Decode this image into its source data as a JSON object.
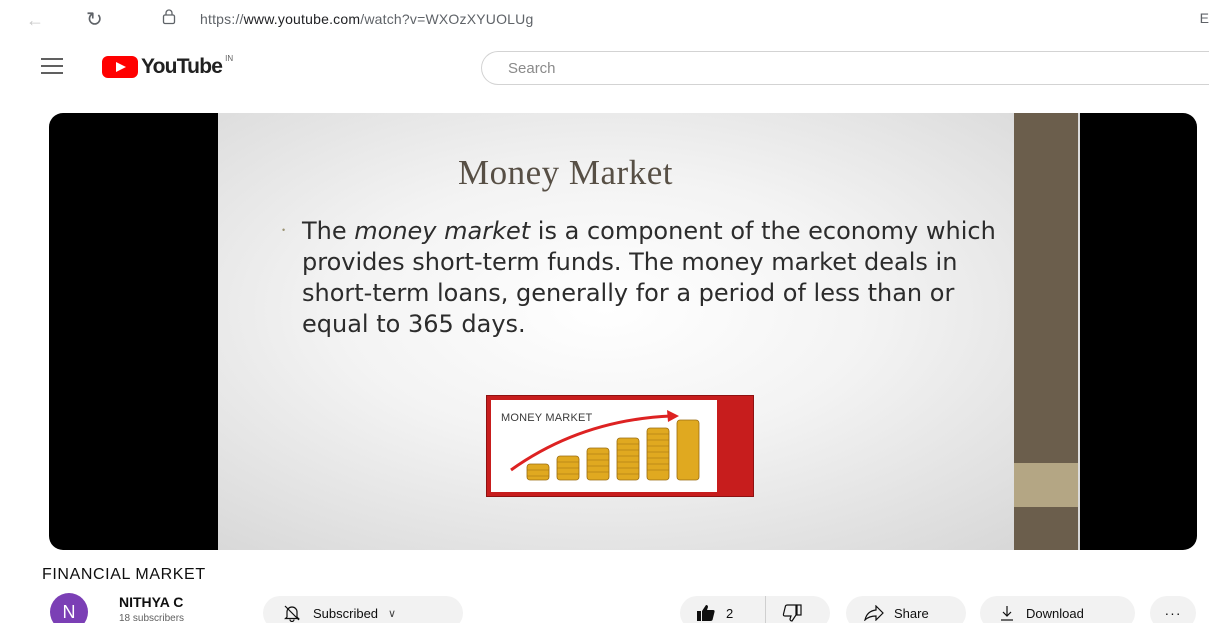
{
  "browser": {
    "url_prefix": "https://",
    "url_domain": "www.youtube.com",
    "url_path": "/watch?v=WXOzXYUOLUg",
    "menu_glyph": "E"
  },
  "header": {
    "logo_text": "YouTube",
    "region": "IN",
    "search_placeholder": "Search"
  },
  "slide": {
    "title": "Money Market",
    "bullet": "•",
    "body_pre": "The ",
    "body_em": "money market",
    "body_post": " is a component of the economy which provides short-term funds. The money market deals in short-term loans, generally for a period of less than or equal to 365 days.",
    "image_label": "MONEY MARKET"
  },
  "video": {
    "title": "FINANCIAL MARKET",
    "channel_initial": "N",
    "channel_name": "NITHYA C",
    "channel_subs": "18 subscribers"
  },
  "actions": {
    "subscribed_label": "Subscribed",
    "like_count": "2",
    "share_label": "Share",
    "download_label": "Download",
    "more_label": "···"
  },
  "colors": {
    "brand_red": "#ff0000",
    "slide_stripe": "#6b5e4c",
    "avatar": "#7b3fb5"
  }
}
